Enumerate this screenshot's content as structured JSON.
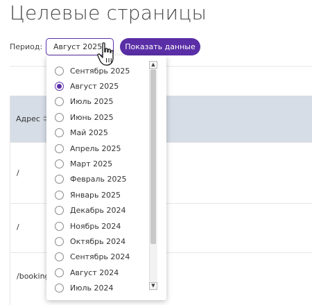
{
  "page": {
    "title": "Целевые страницы"
  },
  "filter": {
    "period_label": "Период:",
    "selected": "Август 2025",
    "show_button": "Показать данные"
  },
  "table": {
    "column_address": "Адрес",
    "rows": [
      "/",
      "/",
      "/booking"
    ]
  },
  "dropdown": {
    "options": [
      {
        "label": "Сентябрь 2025",
        "checked": false
      },
      {
        "label": "Август 2025",
        "checked": true
      },
      {
        "label": "Июль 2025",
        "checked": false
      },
      {
        "label": "Июнь 2025",
        "checked": false
      },
      {
        "label": "Май 2025",
        "checked": false
      },
      {
        "label": "Апрель 2025",
        "checked": false
      },
      {
        "label": "Март 2025",
        "checked": false
      },
      {
        "label": "Февраль 2025",
        "checked": false
      },
      {
        "label": "Январь 2025",
        "checked": false
      },
      {
        "label": "Декабрь 2024",
        "checked": false
      },
      {
        "label": "Ноябрь 2024",
        "checked": false
      },
      {
        "label": "Октябрь 2024",
        "checked": false
      },
      {
        "label": "Сентябрь 2024",
        "checked": false
      },
      {
        "label": "Август 2024",
        "checked": false
      },
      {
        "label": "Июль 2024",
        "checked": false
      }
    ]
  },
  "colors": {
    "accent": "#5a2ea6",
    "header_bg": "#d6dde6"
  }
}
